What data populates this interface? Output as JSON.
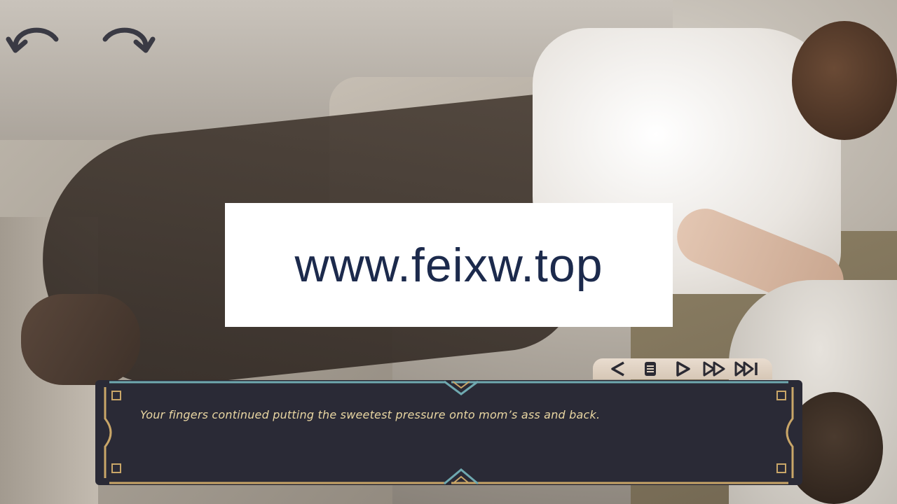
{
  "navigation": {
    "undo_icon": "curved-arrow-left-icon",
    "redo_icon": "curved-arrow-right-icon"
  },
  "watermark": {
    "text": "www.feixw.top"
  },
  "quick_menu": {
    "buttons": [
      {
        "icon": "back-triangle-icon"
      },
      {
        "icon": "menu-lines-icon"
      },
      {
        "icon": "play-triangle-icon"
      },
      {
        "icon": "fast-forward-icon"
      },
      {
        "icon": "skip-to-end-icon"
      }
    ]
  },
  "dialogue": {
    "text": "Your fingers continued putting the sweetest pressure onto mom’s ass and back."
  },
  "colors": {
    "dialogue_bg": "#2a2a36",
    "dialogue_text": "#e9d6a2",
    "frame_gold": "#c9a668",
    "frame_teal": "#6fa9b0",
    "quick_menu_bg": "#e3d5c4",
    "icon_dark": "#2b2a33"
  }
}
